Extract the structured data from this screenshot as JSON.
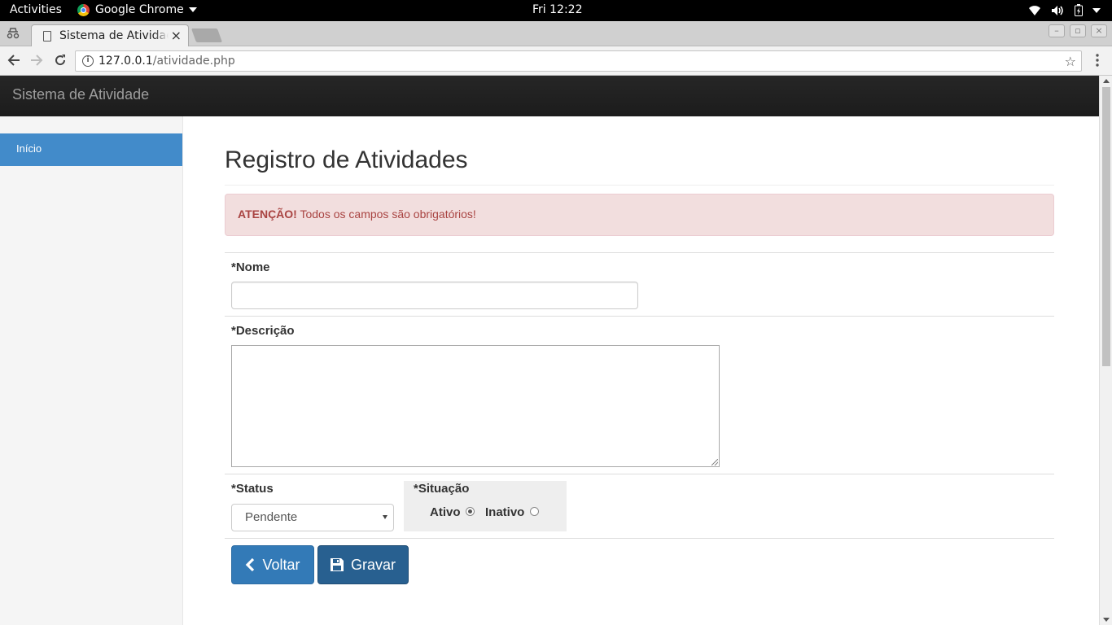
{
  "system_bar": {
    "activities": "Activities",
    "app_name": "Google Chrome",
    "clock": "Fri 12:22",
    "tray_icons": [
      "wifi-icon",
      "volume-icon",
      "battery-icon",
      "system-menu-icon"
    ]
  },
  "browser": {
    "tab_title": "Sistema de Atividade",
    "tab_close": "×",
    "url_host": "127.0.0.1",
    "url_path": "/atividade.php",
    "bookmark_star": "☆"
  },
  "app": {
    "brand": "Sistema de Atividade",
    "sidebar": {
      "items": [
        {
          "label": "Início",
          "active": true
        }
      ]
    }
  },
  "page": {
    "title": "Registro de Atividades",
    "alert": {
      "strong": "ATENÇÃO!",
      "text": " Todos os campos são obrigatórios!"
    },
    "form": {
      "nome_label": "*Nome",
      "nome_value": "",
      "descricao_label": "*Descrição",
      "descricao_value": "",
      "status_label": "*Status",
      "status_selected": "Pendente",
      "situacao_label": "*Situação",
      "situacao_options": [
        {
          "label": "Ativo",
          "checked": true
        },
        {
          "label": "Inativo",
          "checked": false
        }
      ]
    },
    "buttons": {
      "voltar": "Voltar",
      "gravar": "Gravar"
    }
  },
  "colors": {
    "primary": "#337ab7",
    "primary_dark": "#286090",
    "alert_bg": "#f2dede",
    "alert_text": "#a94442",
    "navbar_bg": "#222222",
    "sidebar_active": "#428bca"
  }
}
